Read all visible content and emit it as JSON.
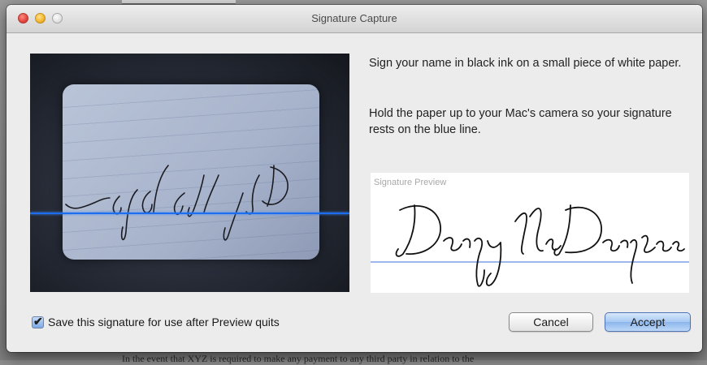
{
  "window": {
    "title": "Signature Capture"
  },
  "instructions": {
    "line1": "Sign your name in black ink on a small piece of white paper.",
    "line2": "Hold the paper up to your Mac's camera so your signature rests on the blue line."
  },
  "preview": {
    "label": "Signature Preview",
    "signature_text": "Derpy McDerpface"
  },
  "options": {
    "save_checkbox_label": "Save this signature for use after Preview quits",
    "save_checked": true
  },
  "buttons": {
    "cancel": "Cancel",
    "accept": "Accept"
  },
  "background": {
    "document_text": "In the event that XYZ is required to make any payment to any third party in relation to the"
  },
  "colors": {
    "guide_line": "#1d6df0",
    "preview_line": "#9db8ec",
    "accept_button": "#8cb6ec"
  },
  "icons": {
    "close": "close-button",
    "minimize": "minimize-button",
    "zoom": "zoom-button",
    "checkbox": "checkmark-icon"
  }
}
